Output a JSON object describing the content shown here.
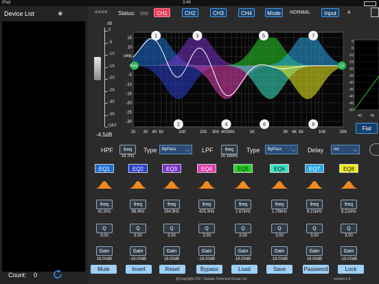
{
  "statusbar": {
    "carrier": "iPad",
    "time": "3:49"
  },
  "sidebar": {
    "title": "Device List",
    "count_label": "Count:",
    "count_value": "0"
  },
  "header": {
    "back_label": "<<<<",
    "status_label": "Status:",
    "channels": [
      "CH1",
      "CH2",
      "CH3",
      "CH4"
    ],
    "mode_label": "Mode",
    "mode_value": "NORMAL",
    "input_label": "Input",
    "input_value": "A"
  },
  "fader": {
    "db_unit": "dB",
    "ticks": [
      "0",
      "-5",
      "-10",
      "-15",
      "-20",
      "-25",
      "-30",
      "-35",
      "OFF"
    ],
    "value": "-4.5dB"
  },
  "graph": {
    "y_unit": "(dB)",
    "y_ticks": [
      "15",
      "10",
      "5",
      "0",
      "-5",
      "-10",
      "-15",
      "-20",
      "-25",
      "-30"
    ],
    "x_ticks": [
      "20",
      "30",
      "40",
      "50",
      "100",
      "200",
      "300",
      "400",
      "500",
      "1K",
      "3K",
      "4K",
      "5K",
      "10K",
      "20K"
    ],
    "hpf_tag": "HPF",
    "lpf_tag": "LP",
    "band_numbers": [
      "1",
      "2",
      "3",
      "4",
      "5",
      "6",
      "7",
      "8"
    ]
  },
  "side_graph": {
    "ticks": [
      "0",
      "-5",
      "-10",
      "-15",
      "-20",
      "-25",
      "-30",
      "-35",
      "-40",
      "-45",
      "-50"
    ],
    "x_labels": [
      "-43",
      "-36"
    ],
    "flat_label": "Flat"
  },
  "filters": {
    "hpf_label": "HPF",
    "hpf_freq_label": "freq",
    "hpf_freq_value": "19.7Hz",
    "type_label": "Type",
    "hpf_type": "ByPass",
    "lpf_label": "LPF",
    "lpf_freq_label": "freq",
    "lpf_freq_value": "20.16kHz",
    "lpf_type": "ByPass",
    "delay_label": "Delay",
    "delay_unit": "ms"
  },
  "eq": {
    "bands": [
      {
        "label": "EQ1",
        "color": "#1e6fd6",
        "freq": "42.2Hz",
        "q": "3.00",
        "gain": "18.00dB"
      },
      {
        "label": "EQ2",
        "color": "#2a3fd0",
        "freq": "88.4Hz",
        "q": "3.00",
        "gain": "-18.00dB"
      },
      {
        "label": "EQ3",
        "color": "#7a32c8",
        "freq": "164.9Hz",
        "q": "3.00",
        "gain": "18.00dB"
      },
      {
        "label": "EQ4",
        "color": "#e23fb0",
        "freq": "425.3Hz",
        "q": "3.00",
        "gain": "-18.00dB"
      },
      {
        "label": "EQ5",
        "color": "#28d228",
        "freq": "1.67kHz",
        "q": "3.00",
        "gain": "18.00dB"
      },
      {
        "label": "EQ6",
        "color": "#3ae6c8",
        "freq": "1.79kHz",
        "q": "3.00",
        "gain": "-18.00dB"
      },
      {
        "label": "EQ7",
        "color": "#2aa7ea",
        "freq": "6.21kHz",
        "q": "3.00",
        "gain": "18.00dB"
      },
      {
        "label": "EQ8",
        "color": "#f0f020",
        "freq": "6.21kHz",
        "q": "3.00",
        "gain": "-18.00dB"
      }
    ],
    "freq_label": "freq",
    "q_label": "Q",
    "gain_label": "Gain"
  },
  "actions": [
    "Mute",
    "Invert",
    "Reset",
    "Bypass",
    "Load",
    "Save",
    "Password",
    "Lock"
  ],
  "footer": {
    "copyright": "@Copyright 2017 Sekaku Technical Group Ltd.",
    "version": "version:1.4"
  },
  "colors": {
    "accent": "#4aa0e6",
    "active_channel": "#ef3b55",
    "action_button": "#9fd0f5"
  }
}
